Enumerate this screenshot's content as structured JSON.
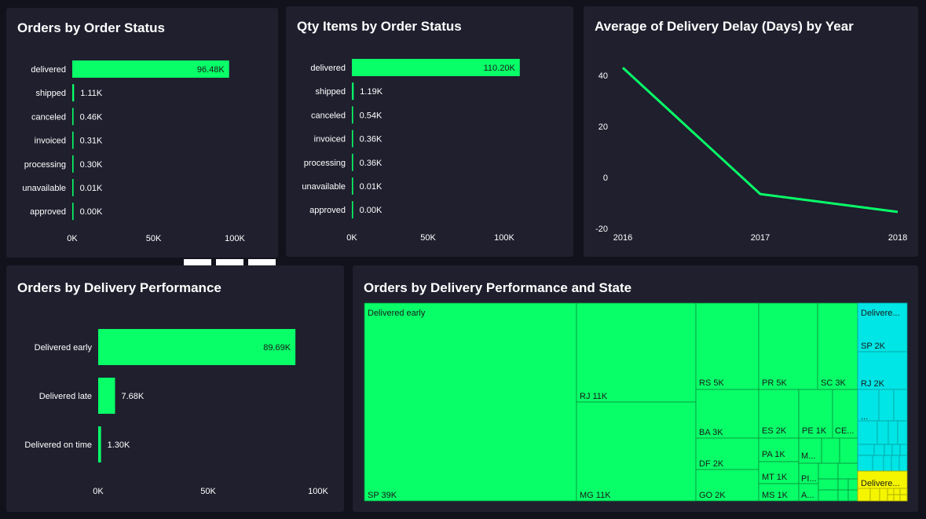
{
  "colors": {
    "background": "#12121c",
    "card": "#1f1f2e",
    "green": "#08ff68",
    "cyan": "#00e5e5",
    "yellow": "#f5f500",
    "text": "#ffffff",
    "dark_text": "#1a1a1a"
  },
  "chart_data": [
    {
      "id": "orders-by-status",
      "type": "bar",
      "orientation": "horizontal",
      "title": "Orders by Order Status",
      "categories": [
        "delivered",
        "shipped",
        "canceled",
        "invoiced",
        "processing",
        "unavailable",
        "approved"
      ],
      "values": [
        96.48,
        1.11,
        0.46,
        0.31,
        0.3,
        0.01,
        0.0
      ],
      "value_labels": [
        "96.48K",
        "1.11K",
        "0.46K",
        "0.31K",
        "0.30K",
        "0.01K",
        "0.00K"
      ],
      "xticks": [
        "0K",
        "50K",
        "100K"
      ],
      "xlim": [
        0,
        100
      ],
      "unit": "K"
    },
    {
      "id": "qty-items-by-status",
      "type": "bar",
      "orientation": "horizontal",
      "title": "Qty Items by Order Status",
      "categories": [
        "delivered",
        "shipped",
        "canceled",
        "invoiced",
        "processing",
        "unavailable",
        "approved"
      ],
      "values": [
        110.2,
        1.19,
        0.54,
        0.36,
        0.36,
        0.01,
        0.0
      ],
      "value_labels": [
        "110.20K",
        "1.19K",
        "0.54K",
        "0.36K",
        "0.36K",
        "0.01K",
        "0.00K"
      ],
      "xticks": [
        "0K",
        "50K",
        "100K"
      ],
      "xlim": [
        0,
        100
      ],
      "unit": "K"
    },
    {
      "id": "avg-delay-by-year",
      "type": "line",
      "title": "Average of Delivery Delay (Days) by Year",
      "x": [
        "2016",
        "2017",
        "2018"
      ],
      "y": [
        43,
        -6.5,
        -13.5
      ],
      "yticks": [
        "40",
        "20",
        "0",
        "-20"
      ],
      "ylim": [
        -20,
        40
      ]
    },
    {
      "id": "orders-by-delivery-performance",
      "type": "bar",
      "orientation": "horizontal",
      "title": "Orders by Delivery Performance",
      "categories": [
        "Delivered early",
        "Delivered late",
        "Delivered on time"
      ],
      "values": [
        89.69,
        7.68,
        1.3
      ],
      "value_labels": [
        "89.69K",
        "7.68K",
        "1.30K"
      ],
      "xticks": [
        "0K",
        "50K",
        "100K"
      ],
      "xlim": [
        0,
        100
      ],
      "unit": "K"
    },
    {
      "id": "treemap-delivery-state",
      "type": "treemap",
      "title": "Orders by Delivery Performance and State",
      "groups": [
        {
          "name": "Delivered early",
          "label": "Delivered early",
          "items": [
            {
              "label": "SP 39K"
            },
            {
              "label": "RJ 11K"
            },
            {
              "label": "MG 11K"
            },
            {
              "label": "RS 5K"
            },
            {
              "label": "PR 5K"
            },
            {
              "label": "SC 3K"
            },
            {
              "label": "BA 3K"
            },
            {
              "label": "DF 2K"
            },
            {
              "label": "GO 2K"
            },
            {
              "label": "ES 2K"
            },
            {
              "label": "PE 1K"
            },
            {
              "label": "CE..."
            },
            {
              "label": "PA 1K"
            },
            {
              "label": "M..."
            },
            {
              "label": "MT 1K"
            },
            {
              "label": "PI..."
            },
            {
              "label": "MS 1K"
            },
            {
              "label": "A..."
            }
          ]
        },
        {
          "name": "Delivered late",
          "label": "Delivere...",
          "items": [
            {
              "label": "SP 2K"
            },
            {
              "label": "RJ 2K"
            },
            {
              "label": "..."
            }
          ]
        },
        {
          "name": "Delivered on time",
          "label": "Delivere...",
          "items": []
        }
      ]
    }
  ]
}
